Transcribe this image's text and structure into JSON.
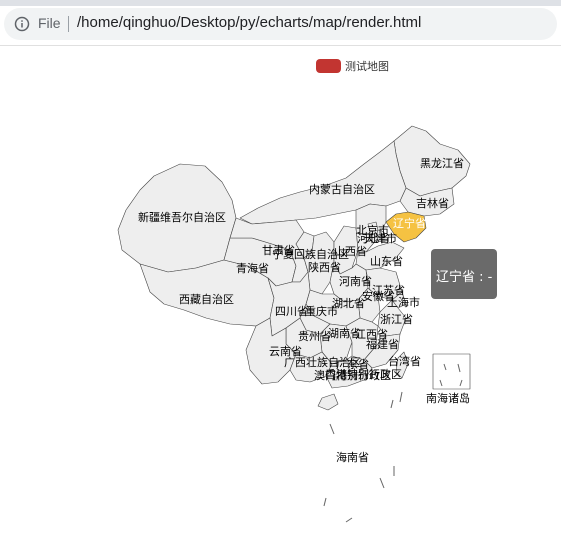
{
  "browser": {
    "scheme_label": "File",
    "url": "/home/qinghuo/Desktop/py/echarts/map/render.html",
    "info_icon": "info-icon"
  },
  "map": {
    "legend": {
      "label": "测试地图",
      "color": "#c23531"
    },
    "highlight_color": "#f5c242",
    "land_color": "#eeeeee",
    "border_color": "#444444",
    "tooltip": {
      "text": "辽宁省 : -"
    },
    "provinces": {
      "heilongjiang": "黑龙江省",
      "jilin": "吉林省",
      "liaoning": "辽宁省",
      "neimenggu": "内蒙古自治区",
      "xinjiang": "新疆维吾尔自治区",
      "beijing": "北京市",
      "tianjin": "天津市",
      "hebei": "河北省",
      "shanxi": "山西省",
      "gansu": "甘肃省",
      "ningxia": "宁夏回族自治区",
      "qinghai": "青海省",
      "shaanxi": "陕西省",
      "shandong": "山东省",
      "henan": "河南省",
      "jiangsu": "江苏省",
      "anhui": "安徽省",
      "shanghai": "上海市",
      "xizang": "西藏自治区",
      "hubei": "湖北省",
      "sichuan": "四川省",
      "chongqing": "重庆市",
      "zhejiang": "浙江省",
      "hunan": "湖南省",
      "jiangxi": "江西省",
      "guizhou": "贵州省",
      "fujian": "福建省",
      "yunnan": "云南省",
      "guangxi": "广西壮族自治区",
      "guangdong": "广东省",
      "taiwan": "台湾省",
      "xianggang": "香港特别行政区",
      "aomen": "澳门特别行政区",
      "hainan": "海南省",
      "nanhai": "南海诸岛"
    }
  }
}
